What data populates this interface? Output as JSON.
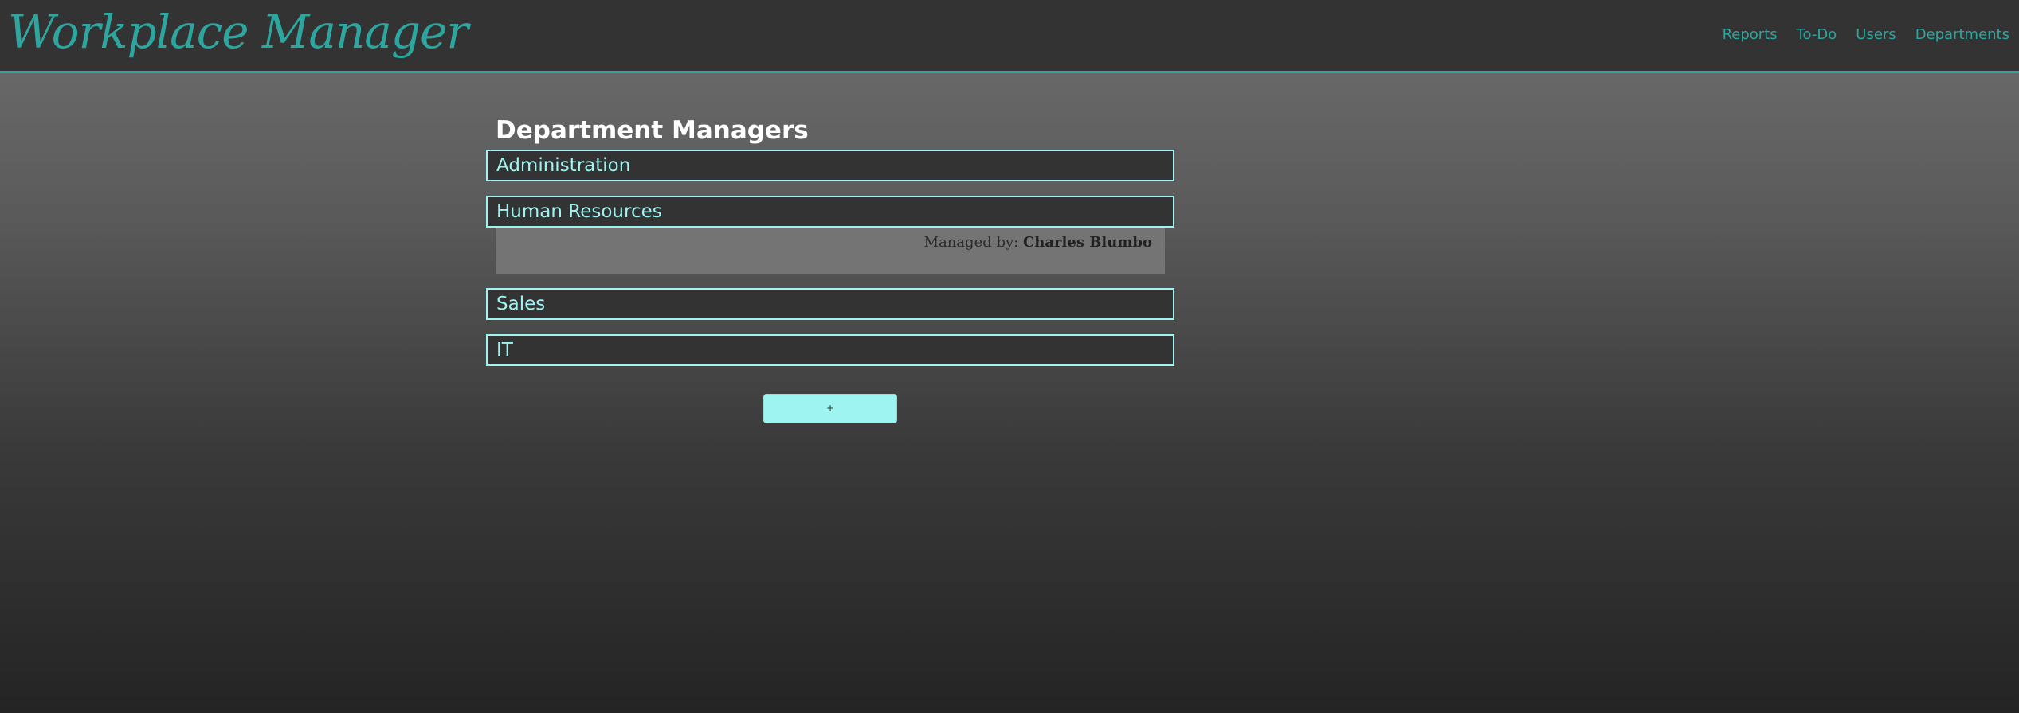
{
  "app": {
    "title": "Workplace Manager"
  },
  "nav": {
    "items": [
      {
        "label": "Reports"
      },
      {
        "label": "To-Do"
      },
      {
        "label": "Users"
      },
      {
        "label": "Departments"
      }
    ]
  },
  "main": {
    "title": "Department Managers",
    "departments": [
      {
        "name": "Administration",
        "expanded": false
      },
      {
        "name": "Human Resources",
        "expanded": true,
        "managed_by_label": "Managed by:",
        "manager": "Charles Blumbo"
      },
      {
        "name": "Sales",
        "expanded": false
      },
      {
        "name": "IT",
        "expanded": false
      }
    ],
    "add_button_label": "+"
  },
  "colors": {
    "accent": "#2ea69f",
    "department_border": "#9ef4f0",
    "header_bg": "#333333",
    "panel_bg": "#747474"
  }
}
